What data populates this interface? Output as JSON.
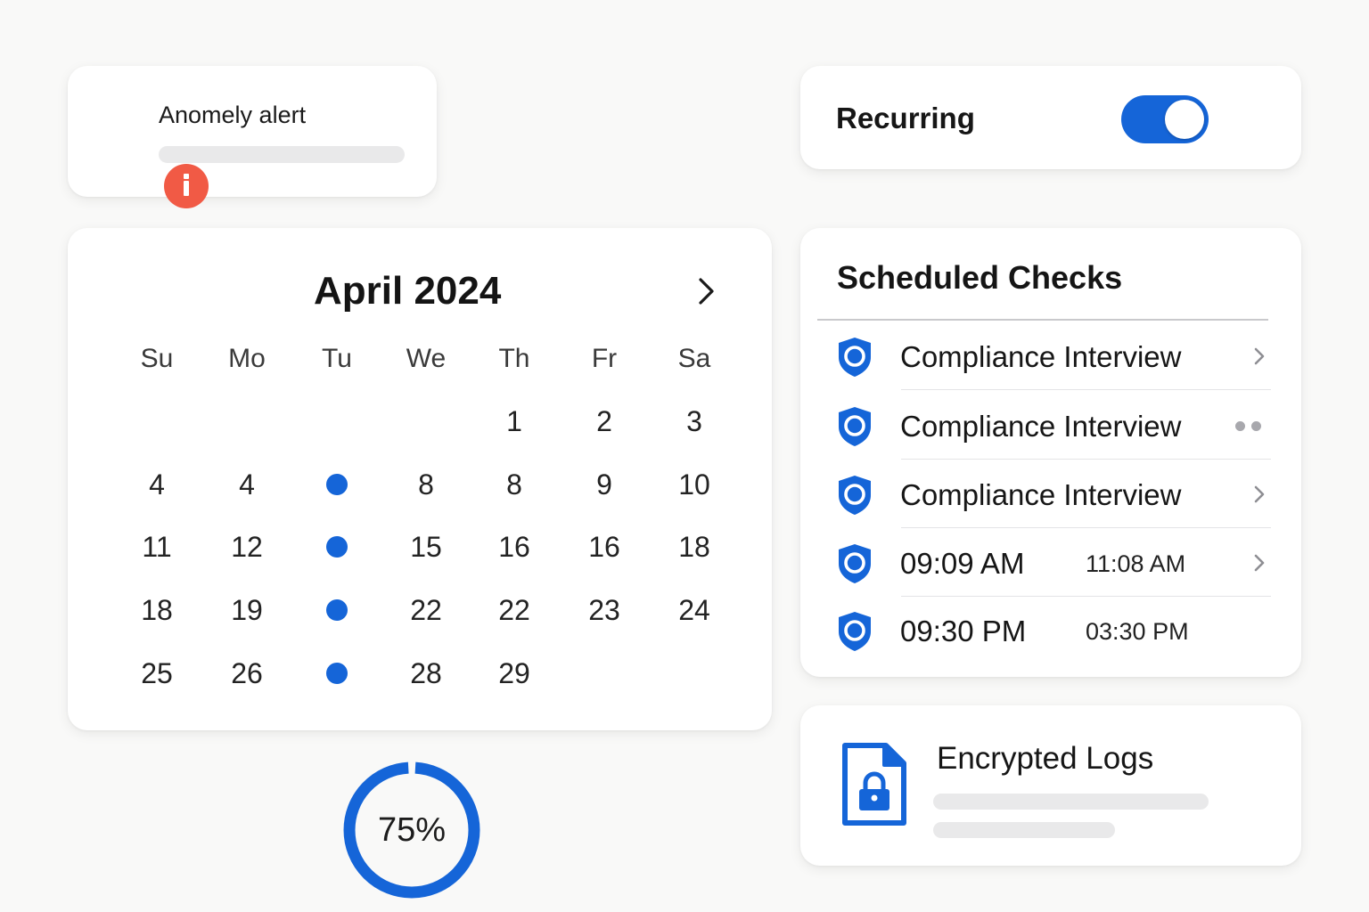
{
  "alert": {
    "title": "Anomely alert",
    "icon": "info-icon",
    "icon_color": "#f15a45"
  },
  "recurring": {
    "label": "Recurring",
    "enabled": true,
    "accent": "#1565d8"
  },
  "calendar": {
    "month_title": "April 2024",
    "next_icon": "chevron-right-icon",
    "weekdays": [
      "Su",
      "Mo",
      "Tu",
      "We",
      "Th",
      "Fr",
      "Sa"
    ],
    "weeks": [
      [
        "",
        "",
        "",
        "",
        "1",
        "2",
        "3"
      ],
      [
        "4",
        "4",
        "•",
        "8",
        "8",
        "9",
        "10"
      ],
      [
        "11",
        "12",
        "•",
        "15",
        "16",
        "16",
        "18"
      ],
      [
        "18",
        "19",
        "•",
        "22",
        "22",
        "23",
        "24"
      ],
      [
        "25",
        "26",
        "•",
        "28",
        "29",
        "",
        ""
      ]
    ],
    "marker_color": "#1565d8"
  },
  "progress": {
    "label": "75%",
    "fraction": 0.75,
    "color": "#1565d8"
  },
  "scheduled_checks": {
    "title": "Scheduled Checks",
    "rows": [
      {
        "label": "Compliance Interview",
        "secondary": "",
        "trailing": "chevron-right-icon"
      },
      {
        "label": "Compliance Interview",
        "secondary": "",
        "trailing": "more-dots-icon"
      },
      {
        "label": "Compliance Interview",
        "secondary": "",
        "trailing": "chevron-right-icon"
      },
      {
        "label": "09:09 AM",
        "secondary": "11:08 AM",
        "trailing": "chevron-right-icon"
      },
      {
        "label": "09:30 PM",
        "secondary": "03:30 PM",
        "trailing": ""
      }
    ],
    "row_icon": "shield-icon"
  },
  "encrypted_logs": {
    "title": "Encrypted Logs",
    "icon": "file-lock-icon"
  }
}
